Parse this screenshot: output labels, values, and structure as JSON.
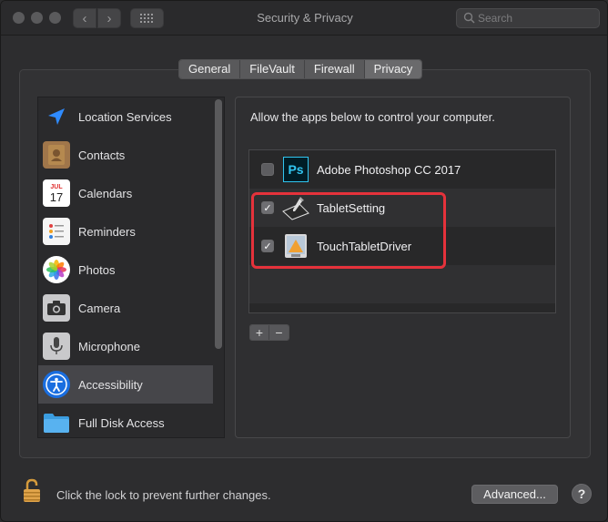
{
  "window": {
    "title": "Security & Privacy"
  },
  "search": {
    "placeholder": "Search"
  },
  "tabs": [
    {
      "label": "General"
    },
    {
      "label": "FileVault"
    },
    {
      "label": "Firewall"
    },
    {
      "label": "Privacy",
      "active": true
    }
  ],
  "sidebar": {
    "items": [
      {
        "label": "Location Services",
        "icon": "location-arrow-icon"
      },
      {
        "label": "Contacts",
        "icon": "contacts-book-icon"
      },
      {
        "label": "Calendars",
        "icon": "calendar-icon",
        "calendar_month": "JUL",
        "calendar_day": "17"
      },
      {
        "label": "Reminders",
        "icon": "reminders-list-icon"
      },
      {
        "label": "Photos",
        "icon": "photos-flower-icon"
      },
      {
        "label": "Camera",
        "icon": "camera-icon"
      },
      {
        "label": "Microphone",
        "icon": "microphone-icon"
      },
      {
        "label": "Accessibility",
        "icon": "accessibility-icon",
        "selected": true
      },
      {
        "label": "Full Disk Access",
        "icon": "folder-icon"
      }
    ]
  },
  "main": {
    "description": "Allow the apps below to control your computer.",
    "apps": [
      {
        "label": "Adobe Photoshop CC 2017",
        "checked": false,
        "icon": "photoshop-icon",
        "icon_text": "Ps"
      },
      {
        "label": "TabletSetting",
        "checked": true,
        "icon": "tablet-pen-icon"
      },
      {
        "label": "TouchTabletDriver",
        "checked": true,
        "icon": "tablet-driver-icon"
      }
    ],
    "add_label": "+",
    "remove_label": "−"
  },
  "footer": {
    "lock_text": "Click the lock to prevent further changes.",
    "advanced_label": "Advanced...",
    "help_label": "?"
  },
  "colors": {
    "highlight": "#e5323b",
    "accent_blue": "#1a6ee0",
    "window_bg": "#2d2d2f"
  }
}
